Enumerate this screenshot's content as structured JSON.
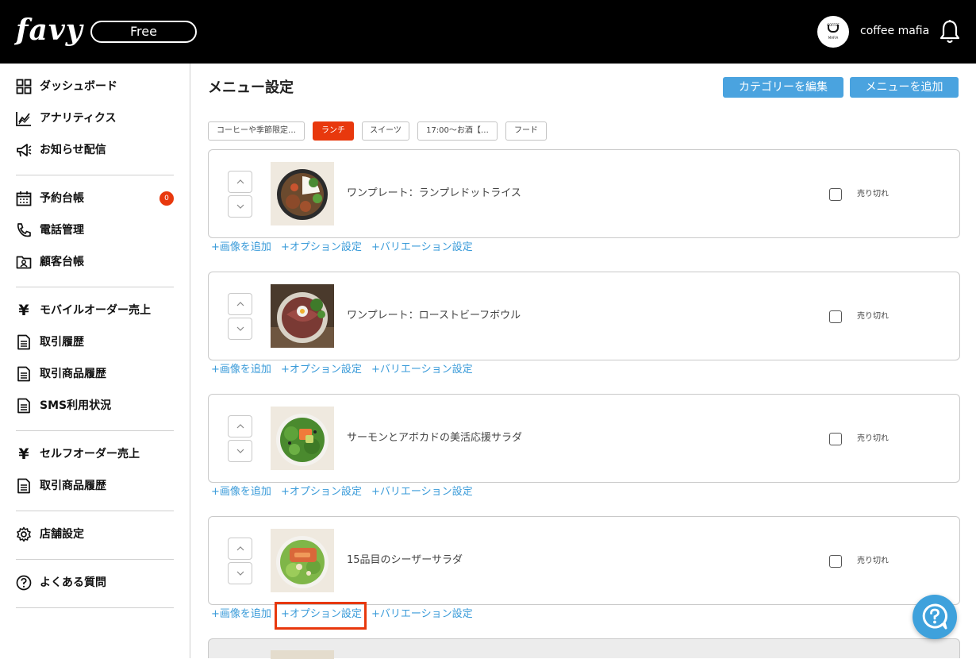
{
  "header": {
    "logo": "favy",
    "plan": "Free",
    "avatar_text": [
      "COFFEE",
      "MAFIA"
    ],
    "user_name": "coffee mafia"
  },
  "sidebar": {
    "groups": [
      [
        {
          "label": "ダッシュボード",
          "icon": "dashboard-icon"
        },
        {
          "label": "アナリティクス",
          "icon": "analytics-icon"
        },
        {
          "label": "お知らせ配信",
          "icon": "megaphone-icon"
        }
      ],
      [
        {
          "label": "予約台帳",
          "icon": "calendar-icon",
          "badge": "0"
        },
        {
          "label": "電話管理",
          "icon": "phone-icon"
        },
        {
          "label": "顧客台帳",
          "icon": "customer-icon"
        }
      ],
      [
        {
          "label": "モバイルオーダー売上",
          "icon": "yen-icon"
        },
        {
          "label": "取引履歴",
          "icon": "document-icon"
        },
        {
          "label": "取引商品履歴",
          "icon": "document-icon"
        },
        {
          "label": "SMS利用状況",
          "icon": "document-icon"
        }
      ],
      [
        {
          "label": "セルフオーダー売上",
          "icon": "yen-icon"
        },
        {
          "label": "取引商品履歴",
          "icon": "document-icon"
        }
      ],
      [
        {
          "label": "店舗設定",
          "icon": "gear-icon"
        }
      ],
      [
        {
          "label": "よくある質問",
          "icon": "help-icon"
        }
      ]
    ]
  },
  "main": {
    "title": "メニュー設定",
    "edit_category_label": "カテゴリーを編集",
    "add_menu_label": "メニューを追加",
    "categories": [
      {
        "label": "コーヒーや季節限定…",
        "active": false
      },
      {
        "label": "ランチ",
        "active": true
      },
      {
        "label": "スイーツ",
        "active": false
      },
      {
        "label": "17:00〜お酒【…",
        "active": false
      },
      {
        "label": "フード",
        "active": false
      }
    ],
    "soldout_label": "売り切れ",
    "link_labels": {
      "add_image": "+画像を追加",
      "option": "+オプション設定",
      "variation": "+バリエーション設定"
    },
    "items": [
      {
        "name": "ワンプレート：ランプレドットライス",
        "sold_out": false
      },
      {
        "name": "ワンプレート：ローストビーフボウル",
        "sold_out": false
      },
      {
        "name": "サーモンとアボカドの美活応援サラダ",
        "sold_out": false
      },
      {
        "name": "15品目のシーザーサラダ",
        "sold_out": false
      }
    ]
  },
  "colors": {
    "accent": "#4aa3df",
    "active_tab": "#e8380d",
    "link": "#3a9bd9",
    "highlight": "#e8380d"
  }
}
